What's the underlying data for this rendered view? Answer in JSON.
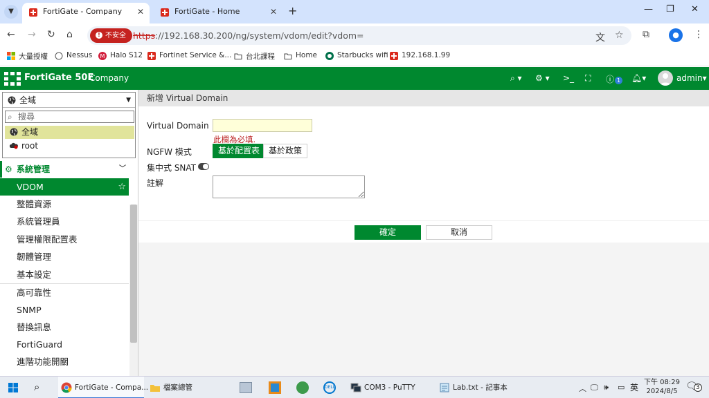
{
  "browser": {
    "tabs": [
      {
        "title": "FortiGate - Company",
        "active": true
      },
      {
        "title": "FortiGate - Home",
        "active": false
      }
    ],
    "security_label": "不安全",
    "url_scheme": "https",
    "url_rest": "://192.168.30.200/ng/system/vdom/edit?vdom=",
    "bookmarks": [
      "大量授權",
      "Nessus",
      "Halo S12",
      "Fortinet Service &...",
      "台北課程",
      "Home",
      "Starbucks wifi",
      "192.168.1.99"
    ]
  },
  "fortigate": {
    "product": "FortiGate 50E",
    "hostname": "Company",
    "user": "admin",
    "help_badge": "1",
    "accent_color": "#00882f",
    "vdom_selector": {
      "selected": "全域",
      "search_placeholder": "搜尋",
      "options": [
        "全域",
        "root"
      ]
    },
    "nav": {
      "section": "系統管理",
      "items": [
        "VDOM",
        "整體資源",
        "系統管理員",
        "管理權限配置表",
        "韌體管理",
        "基本設定",
        "高可靠性",
        "SNMP",
        "替換訊息",
        "FortiGuard",
        "進階功能開關"
      ]
    },
    "page_title": "新增 Virtual Domain",
    "form": {
      "vd_label": "Virtual Domain",
      "vd_value": "",
      "vd_error": "此欄為必填.",
      "ngfw_label": "NGFW 模式",
      "ngfw_options": [
        "基於配置表",
        "基於政策"
      ],
      "ngfw_selected": "基於配置表",
      "snat_label": "集中式 SNAT",
      "snat_enabled": false,
      "comment_label": "註解",
      "comment_value": ""
    },
    "buttons": {
      "ok": "確定",
      "cancel": "取消"
    }
  },
  "taskbar": {
    "apps": [
      "FortiGate - Compa...",
      "檔案總管",
      "COM3 - PuTTY",
      "Lab.txt - 記事本"
    ],
    "ime": "英",
    "time": "下午 08:29",
    "date": "2024/8/5",
    "notifications": "3"
  }
}
